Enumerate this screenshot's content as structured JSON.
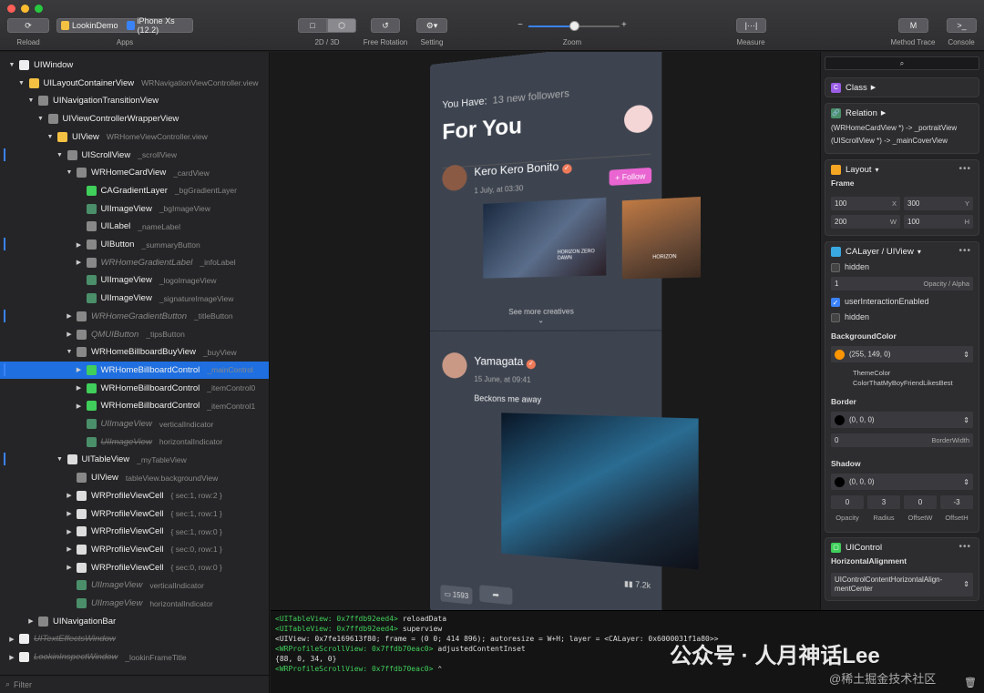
{
  "toolbar": {
    "reload_label": "Reload",
    "apps_label": "Apps",
    "app_name": "LookinDemo",
    "device_name": "iPhone Xs (12.2)",
    "view_mode_label": "2D / 3D",
    "rotation_label": "Free Rotation",
    "setting_label": "Setting",
    "zoom_label": "Zoom",
    "zoom_minus": "−",
    "zoom_plus": "+",
    "zoom_level": 0.5,
    "measure_label": "Measure",
    "method_trace_label": "Method Trace",
    "console_label": "Console",
    "measure_icon": "|···|",
    "method_trace_icon": "M",
    "console_icon": ">_"
  },
  "hierarchy": [
    {
      "indent": 0,
      "tri": "▼",
      "name": "UIWindow",
      "member": "",
      "icon": "#eee",
      "style": ""
    },
    {
      "indent": 1,
      "tri": "▼",
      "name": "UILayoutContainerView",
      "member": "WRNavigationViewController.view",
      "icon": "#f5c142",
      "style": ""
    },
    {
      "indent": 2,
      "tri": "▼",
      "name": "UINavigationTransitionView",
      "member": "",
      "icon": "#888",
      "style": ""
    },
    {
      "indent": 3,
      "tri": "▼",
      "name": "UIViewControllerWrapperView",
      "member": "",
      "icon": "#888",
      "style": ""
    },
    {
      "indent": 4,
      "tri": "▼",
      "name": "UIView",
      "member": "WRHomeViewController.view",
      "icon": "#f5c142",
      "style": ""
    },
    {
      "indent": 5,
      "tri": "▼",
      "name": "UIScrollView",
      "member": "_scrollView",
      "icon": "#888",
      "style": ""
    },
    {
      "indent": 6,
      "tri": "▼",
      "name": "WRHomeCardView",
      "member": "_cardView",
      "icon": "#888",
      "style": ""
    },
    {
      "indent": 7,
      "tri": "",
      "name": "CAGradientLayer",
      "member": "_bgGradientLayer",
      "icon": "#3fcf5a",
      "style": ""
    },
    {
      "indent": 7,
      "tri": "",
      "name": "UIImageView",
      "member": "_bgImageView",
      "icon": "#4a8f6a",
      "style": ""
    },
    {
      "indent": 7,
      "tri": "",
      "name": "UILabel",
      "member": "_nameLabel",
      "icon": "#888",
      "style": ""
    },
    {
      "indent": 7,
      "tri": "▶",
      "name": "UIButton",
      "member": "_summaryButton",
      "icon": "#888",
      "style": ""
    },
    {
      "indent": 7,
      "tri": "▶",
      "name": "WRHomeGradientLabel",
      "member": "_infoLabel",
      "icon": "#888",
      "style": "dim"
    },
    {
      "indent": 7,
      "tri": "",
      "name": "UIImageView",
      "member": "_logoImageView",
      "icon": "#4a8f6a",
      "style": ""
    },
    {
      "indent": 7,
      "tri": "",
      "name": "UIImageView",
      "member": "_signatureImageView",
      "icon": "#4a8f6a",
      "style": ""
    },
    {
      "indent": 6,
      "tri": "▶",
      "name": "WRHomeGradientButton",
      "member": "_titleButton",
      "icon": "#888",
      "style": "dim"
    },
    {
      "indent": 6,
      "tri": "▶",
      "name": "QMUIButton",
      "member": "_tipsButton",
      "icon": "#888",
      "style": "dim"
    },
    {
      "indent": 6,
      "tri": "▼",
      "name": "WRHomeBillboardBuyView",
      "member": "_buyView",
      "icon": "#888",
      "style": ""
    },
    {
      "indent": 7,
      "tri": "▶",
      "name": "WRHomeBillboardControl",
      "member": "_mainControl",
      "icon": "#3fcf5a",
      "style": "sel"
    },
    {
      "indent": 7,
      "tri": "▶",
      "name": "WRHomeBillboardControl",
      "member": "_itemControl0",
      "icon": "#3fcf5a",
      "style": ""
    },
    {
      "indent": 7,
      "tri": "▶",
      "name": "WRHomeBillboardControl",
      "member": "_itemControl1",
      "icon": "#3fcf5a",
      "style": ""
    },
    {
      "indent": 7,
      "tri": "",
      "name": "UIImageView",
      "member": "verticalIndicator",
      "icon": "#4a8f6a",
      "style": "dim"
    },
    {
      "indent": 7,
      "tri": "",
      "name": "UIImageView",
      "member": "horizontalIndicator",
      "icon": "#4a8f6a",
      "style": "dim strike"
    },
    {
      "indent": 5,
      "tri": "▼",
      "name": "UITableView",
      "member": "_myTableView",
      "icon": "#ddd",
      "style": ""
    },
    {
      "indent": 6,
      "tri": "",
      "name": "UIView",
      "member": "tableView.backgroundView",
      "icon": "#888",
      "style": ""
    },
    {
      "indent": 6,
      "tri": "▶",
      "name": "WRProfileViewCell",
      "member": "{ sec:1, row:2 }",
      "icon": "#ddd",
      "style": ""
    },
    {
      "indent": 6,
      "tri": "▶",
      "name": "WRProfileViewCell",
      "member": "{ sec:1, row:1 }",
      "icon": "#ddd",
      "style": ""
    },
    {
      "indent": 6,
      "tri": "▶",
      "name": "WRProfileViewCell",
      "member": "{ sec:1, row:0 }",
      "icon": "#ddd",
      "style": ""
    },
    {
      "indent": 6,
      "tri": "▶",
      "name": "WRProfileViewCell",
      "member": "{ sec:0, row:1 }",
      "icon": "#ddd",
      "style": ""
    },
    {
      "indent": 6,
      "tri": "▶",
      "name": "WRProfileViewCell",
      "member": "{ sec:0, row:0 }",
      "icon": "#ddd",
      "style": ""
    },
    {
      "indent": 6,
      "tri": "",
      "name": "UIImageView",
      "member": "verticalIndicator",
      "icon": "#4a8f6a",
      "style": "dim"
    },
    {
      "indent": 6,
      "tri": "",
      "name": "UIImageView",
      "member": "horizontalIndicator",
      "icon": "#4a8f6a",
      "style": "dim"
    },
    {
      "indent": 2,
      "tri": "▶",
      "name": "UINavigationBar",
      "member": "",
      "icon": "#888",
      "style": ""
    },
    {
      "indent": 0,
      "tri": "▶",
      "name": "UITextEffectsWindow",
      "member": "",
      "icon": "#eee",
      "style": "dim strike"
    },
    {
      "indent": 0,
      "tri": "▶",
      "name": "LookinInspectWindow",
      "member": "_lookinFrameTitle",
      "icon": "#eee",
      "style": "dim strike"
    }
  ],
  "filter_placeholder": "Filter",
  "phone": {
    "you_have": "You Have:",
    "new_followers": "13 new followers",
    "for_you": "For You",
    "user1": "Kero Kero Bonito",
    "date1": "1 July, at 03:30",
    "follow": "+ Follow",
    "see_more": "See more creatives",
    "user2": "Yamagata",
    "date2": "15 June, at 09:41",
    "post": "Beckons me away",
    "views": "7.2k",
    "comments": "1593",
    "image_caption_1": "HORIZON ZERO DAWN",
    "image_caption_2": "HORIZON"
  },
  "console": [
    {
      "obj": "<UITableView: 0x7ffdb92eed4>",
      "msg": "reloadData"
    },
    {
      "obj": "<UITableView: 0x7ffdb92eed4>",
      "msg": "superview"
    },
    {
      "obj": "",
      "msg": "<UIView: 0x7fe169613f80; frame = (0 0; 414 896); autoresize = W+H; layer = <CALayer: 0x6000031f1a80>>"
    },
    {
      "obj": "<WRProfileScrollView: 0x7ffdb70eac0>",
      "msg": "adjustedContentInset"
    },
    {
      "obj": "",
      "msg": "{88, 0, 34, 0}"
    },
    {
      "obj": "<WRProfileScrollView: 0x7ffdb70eac0>",
      "msg": "⌃"
    }
  ],
  "inspector": {
    "class_label": "Class",
    "relation_label": "Relation",
    "relation1": "(WRHomeCardView *) -> _portraitView",
    "relation2": "(UIScrollView *) -> _mainCoverView",
    "layout_label": "Layout",
    "frame_label": "Frame",
    "frame_x": "100",
    "frame_y": "300",
    "frame_w": "200",
    "frame_h": "100",
    "x_label": "X",
    "y_label": "Y",
    "w_label": "W",
    "h_label": "H",
    "calayer_label": "CALayer / UIView",
    "hidden_label": "hidden",
    "opacity_value": "1",
    "opacity_label": "Opacity / Alpha",
    "user_interaction_label": "userInteractionEnabled",
    "hidden2_label": "hidden",
    "bg_color_label": "BackgroundColor",
    "bg_color_value": "(255, 149, 0)",
    "theme_color": "ThemeColor",
    "theme_color_name": "ColorThatMyBoyFriendLikesBest",
    "border_label": "Border",
    "border_value": "(0, 0, 0)",
    "border_width_value": "0",
    "border_width_label": "BorderWidth",
    "shadow_label": "Shadow",
    "shadow_value": "(0, 0, 0)",
    "opacity2": "0",
    "radius": "3",
    "offset_w": "0",
    "offset_h": "-3",
    "opacity2_label": "Opacity",
    "radius_label": "Radius",
    "offset_w_label": "OffsetW",
    "offset_h_label": "OffsetH",
    "uicontrol_label": "UIControl",
    "h_align_label": "HorizontalAlignment",
    "h_align_value_1": "UIControlContentHorizontalAlign-",
    "h_align_value_2": "mentCenter",
    "search_icon": "⌕",
    "chevron": "▾",
    "stepper": "⇕",
    "dots": "•••",
    "check": "✓",
    "class_icon": "C",
    "relation_icon": "🔗",
    "uicontrol_icon": "▢"
  },
  "watermark": "公众号 · 人月神话Lee",
  "watermark2": "@稀土掘金技术社区",
  "colors": {
    "accent": "#3a82f7",
    "orange": "#ff9500",
    "console_green": "#3fcf5a"
  }
}
